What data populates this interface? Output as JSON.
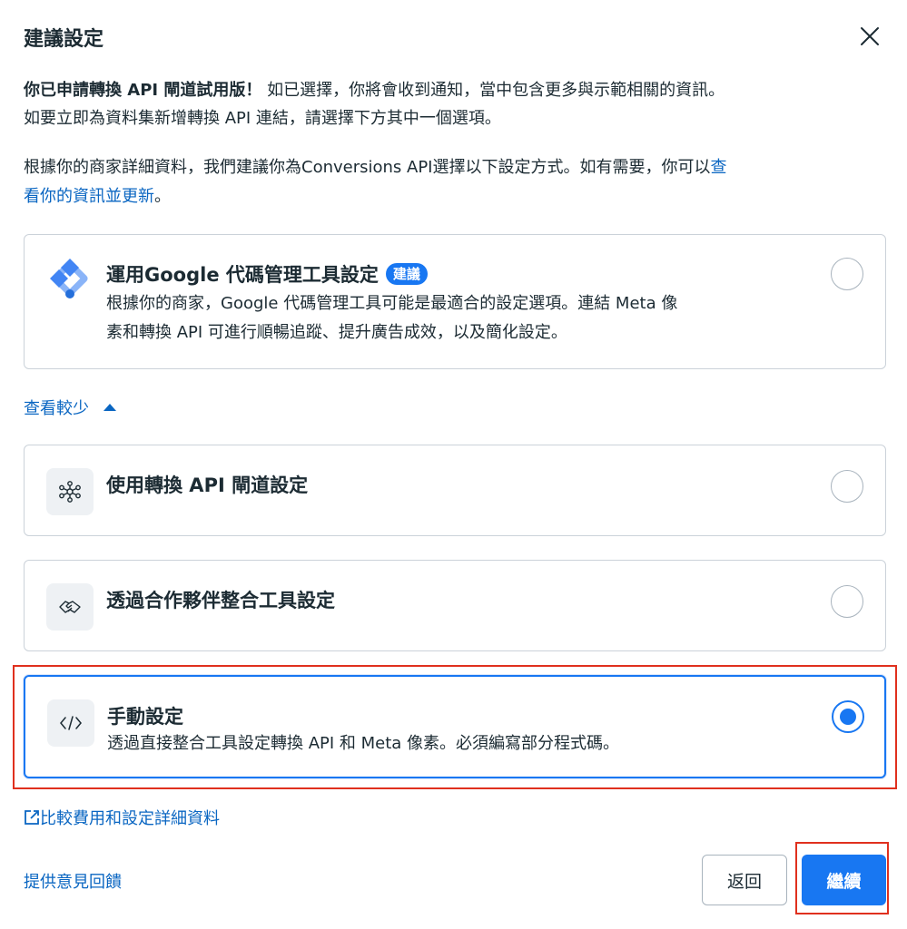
{
  "dialog": {
    "title": "建議設定",
    "close_icon": "close-icon"
  },
  "intro": {
    "bold": "你已申請轉換 API 閘道試用版！",
    "line1_rest": " 如已選擇，你將會收到通知，當中包含更多與示範相關的資訊。",
    "line2": "如要立即為資料集新增轉換 API 連結，請選擇下方其中一個選項。"
  },
  "recommendation": {
    "text_line1": "根據你的商家詳細資料，我們建議你為Conversions API選擇以下設定方式。如有需要，你可以",
    "link_part1": "查",
    "link_part2": "看你的資訊並更新",
    "suffix": "。"
  },
  "options": [
    {
      "title": "運用Google 代碼管理工具設定",
      "badge": "建議",
      "desc_line1": "根據你的商家，Google 代碼管理工具可能是最適合的設定選項。連結 Meta 像",
      "desc_line2": "素和轉換 API 可進行順暢追蹤、提升廣告成效，以及簡化設定。",
      "icon": "google-tag-manager-icon",
      "selected": false
    },
    {
      "title": "使用轉換 API 閘道設定",
      "icon": "network-hub-icon",
      "selected": false
    },
    {
      "title": "透過合作夥伴整合工具設定",
      "icon": "handshake-icon",
      "selected": false
    },
    {
      "title": "手動設定",
      "desc_line1": "透過直接整合工具設定轉換 API 和 Meta 像素。必須編寫部分程式碼。",
      "icon": "code-icon",
      "selected": true
    }
  ],
  "toggle": {
    "label": "查看較少"
  },
  "footer": {
    "compare_link": "比較費用和設定詳細資料",
    "feedback_link": "提供意見回饋",
    "back_label": "返回",
    "continue_label": "繼續"
  },
  "colors": {
    "accent": "#1877f2",
    "link": "#0a66c2",
    "highlight": "#e0301e"
  }
}
